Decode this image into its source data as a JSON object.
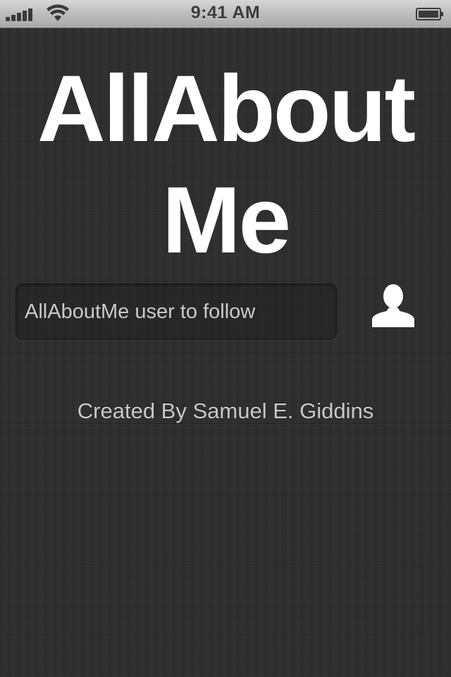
{
  "status_bar": {
    "time": "9:41 AM",
    "icons": [
      "signal-strength-icon",
      "wifi-icon",
      "battery-icon"
    ]
  },
  "app": {
    "title_line1": "AllAbout",
    "title_line2": "Me"
  },
  "follow_form": {
    "username_placeholder": "AllAboutMe user to follow",
    "username_value": "",
    "button_icon": "person-icon"
  },
  "footer": {
    "credit": "Created By Samuel E. Giddins"
  },
  "colors": {
    "background": "#2c2c2c",
    "title_text": "#ffffff",
    "credit_text": "#c8c8c8"
  }
}
